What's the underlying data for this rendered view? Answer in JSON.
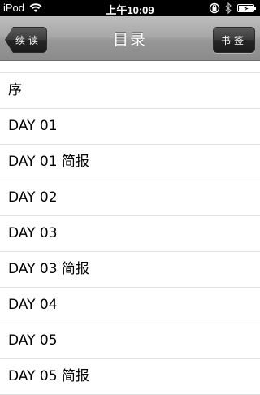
{
  "status_bar": {
    "carrier": "iPod",
    "time": "上午10:09",
    "icons": [
      "wifi-icon",
      "orientation-lock-icon",
      "bluetooth-icon",
      "battery-icon"
    ]
  },
  "nav": {
    "title": "目录",
    "back_label": "续读",
    "right_label": "书签"
  },
  "toc": {
    "items": [
      "序",
      "DAY 01",
      "DAY 01 简报",
      "DAY 02",
      "DAY 03",
      "DAY 03 简报",
      "DAY 04",
      "DAY 05",
      "DAY 05 简报"
    ]
  }
}
